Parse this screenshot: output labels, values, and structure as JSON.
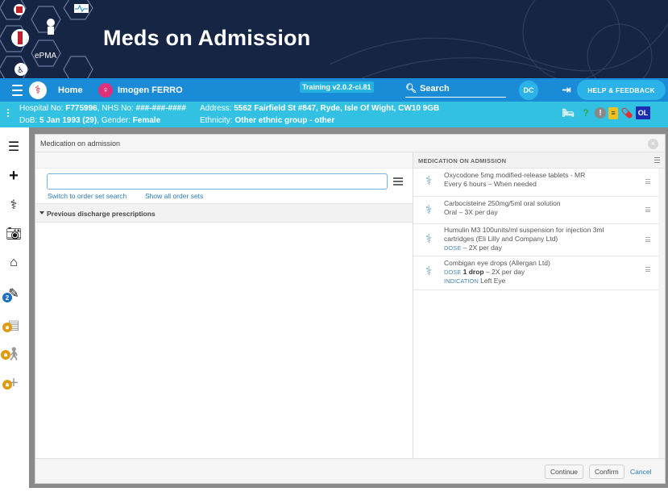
{
  "banner": {
    "title": "Meds on Admission",
    "logo_text": "ePMA"
  },
  "nav": {
    "home_label": "Home",
    "patient_name": "Imogen FERRO",
    "training_label": "Training v2.0.2-ci.81",
    "search_label": "Search",
    "user_initials": "DC",
    "help_label": "HELP & FEEDBACK"
  },
  "patient": {
    "hospital_label": "Hospital No:",
    "hospital_no": "F775996",
    "nhs_label": ", NHS No:",
    "nhs_no": "###-###-####",
    "address_label": "Address:",
    "address": "5562 Fairfield St #847, Ryde, Isle Of Wight, CW10 9GB",
    "dob_label": "DoB:",
    "dob": "5 Jan 1993 (29)",
    "gender_label": ", Gender:",
    "gender": "Female",
    "ethnicity_label": "Ethnicity:",
    "ethnicity": "Other ethnic group - other",
    "ol_badge": "OL"
  },
  "sidebar": {
    "badge_count": "2"
  },
  "modal": {
    "title": "Medication on admission",
    "search_value": "",
    "link_switch": "Switch to order set search",
    "link_show_all": "Show all order sets",
    "section_title": "Previous discharge prescriptions",
    "right_title": "MEDICATION ON ADMISSION",
    "meds": [
      {
        "line1": "Oxycodone 5mg modified-release tablets - MR",
        "line2": "Every 6 hours – When needed"
      },
      {
        "line1": "Carbocisteine 250mg/5ml oral solution",
        "line2": "Oral – 3X per day"
      },
      {
        "line1": "Humulin M3 100units/ml suspension for injection 3ml",
        "line1b": "cartridges (Eli Lilly and Company Ltd)",
        "dose_label": "DOSE",
        "line2": " – 2X per day"
      },
      {
        "line1": "Combigan eye drops (Allergan Ltd)",
        "dose_label": "DOSE",
        "dose_value": "1 drop",
        "dose_rest": " – 2X per day",
        "indication_label": "INDICATION",
        "indication_value": "Left Eye"
      }
    ],
    "buttons": {
      "continue": "Continue",
      "confirm": "Confirm",
      "cancel": "Cancel"
    }
  }
}
